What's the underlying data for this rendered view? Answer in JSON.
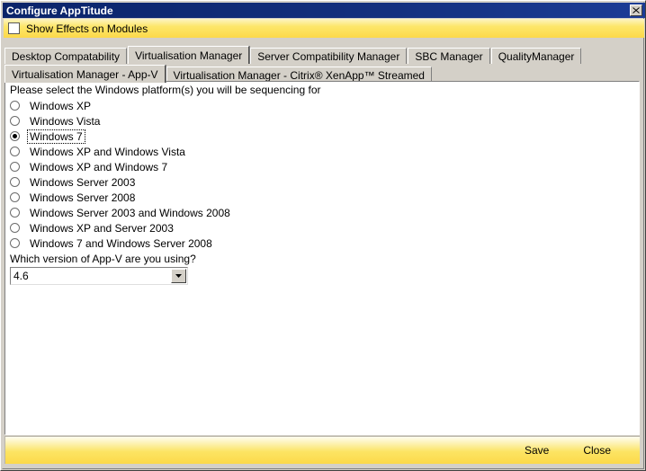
{
  "window": {
    "title": "Configure AppTitude",
    "close_icon": "close-icon",
    "close_label": "X"
  },
  "topbar": {
    "checkbox_label": "Show Effects on Modules",
    "checkbox_checked": false
  },
  "tabs": {
    "primary": [
      {
        "label": "Desktop Compatability",
        "active": false
      },
      {
        "label": "Virtualisation Manager",
        "active": true
      },
      {
        "label": "Server Compatibility Manager",
        "active": false
      },
      {
        "label": "SBC Manager",
        "active": false
      },
      {
        "label": "QualityManager",
        "active": false
      }
    ],
    "secondary": [
      {
        "label": "Virtualisation Manager - App-V",
        "active": true
      },
      {
        "label": "Virtualisation Manager - Citrix® XenApp™ Streamed",
        "active": false
      }
    ]
  },
  "main": {
    "prompt": "Please select the Windows platform(s) you will be sequencing for",
    "platforms": [
      {
        "label": "Windows XP",
        "selected": false
      },
      {
        "label": "Windows Vista",
        "selected": false
      },
      {
        "label": "Windows 7",
        "selected": true
      },
      {
        "label": "Windows XP and Windows Vista",
        "selected": false
      },
      {
        "label": "Windows XP and Windows 7",
        "selected": false
      },
      {
        "label": "Windows Server 2003",
        "selected": false
      },
      {
        "label": "Windows Server 2008",
        "selected": false
      },
      {
        "label": "Windows Server 2003 and Windows 2008",
        "selected": false
      },
      {
        "label": "Windows XP and Server 2003",
        "selected": false
      },
      {
        "label": "Windows 7 and Windows Server 2008",
        "selected": false
      }
    ],
    "version_prompt": "Which version of App-V are you using?",
    "version_value": "4.6",
    "version_options": [
      "4.6"
    ],
    "dropdown_icon": "chevron-down-icon"
  },
  "footer": {
    "save_label": "Save",
    "close_label": "Close"
  },
  "colors": {
    "titlebar": "#0a246a",
    "accent_yellow": "#fcd94a",
    "panel": "#d4d0c8",
    "content": "#ffffff"
  }
}
